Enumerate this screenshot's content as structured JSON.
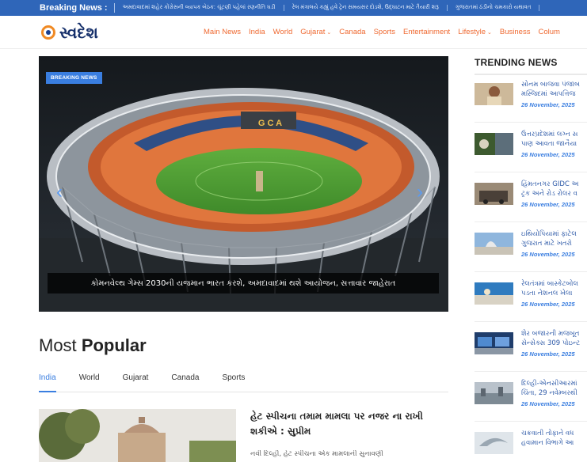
{
  "ticker": {
    "label": "Breaking News :",
    "items": [
      "અમદાવાદમાં શહેર કોંગ્રેસની વ્યાપક બેઠક: ચૂંટણી પહેલાં રણનીતિ ઘડી",
      "રેલ મંત્રાલયે કહ્યું હવે ટ્રેન સમયસર દોડશે, ઉદ્ઘાટન માટે તૈયારી શરૂ",
      "ગુજરાતમાં ઠંડીનો ચમકારો યથાવત"
    ]
  },
  "header": {
    "logo_text": "સ્વદેશ",
    "nav": [
      {
        "label": "Main News",
        "dropdown": false
      },
      {
        "label": "India",
        "dropdown": false
      },
      {
        "label": "World",
        "dropdown": false
      },
      {
        "label": "Gujarat",
        "dropdown": true
      },
      {
        "label": "Canada",
        "dropdown": false
      },
      {
        "label": "Sports",
        "dropdown": false
      },
      {
        "label": "Entertainment",
        "dropdown": false
      },
      {
        "label": "Lifestyle",
        "dropdown": true
      },
      {
        "label": "Business",
        "dropdown": false
      },
      {
        "label": "Colum",
        "dropdown": false
      }
    ]
  },
  "hero": {
    "badge": "BREAKING NEWS",
    "stadium_sign": "G C A",
    "caption": "કોમનવેલ્થ ગેમ્સ 2030ની યજમાન ભારત કરશે, અમદાવાદમાં થશે આયોજન, સત્તાવાર જાહેરાત"
  },
  "most_popular": {
    "title_light": "Most",
    "title_bold": "Popular",
    "tabs": [
      "India",
      "World",
      "Gujarat",
      "Canada",
      "Sports"
    ],
    "active_tab": "India",
    "headline": "હેટ સ્પીચના તમામ મામલા પર નજર ના રાખી શકીએ : સુપ્રીમ",
    "excerpt": "નવી દિલ્હી, હેટ સ્પીચના એક મામલાની સુનાવણી"
  },
  "trending": {
    "title": "TRENDING NEWS",
    "items": [
      {
        "line1": "સોનમ બાજવા પંજાબ",
        "line2": "મસ્જિદમાં આપત્તિજ",
        "date": "26 November, 2025"
      },
      {
        "line1": "ઉત્તરપ્રદેશમાં લગ્ન સ",
        "line2": "પાણ આવતા જાનૈયા",
        "date": "26 November, 2025"
      },
      {
        "line1": "હિંમતનગર GIDC અ",
        "line2": "ટ્રક અને રોડ રોલર વ",
        "date": "26 November, 2025"
      },
      {
        "line1": "ઇથિયોપિયામાં ફાટેલ",
        "line2": "ગુજરાત માટે ખતરો",
        "date": "26 November, 2025"
      },
      {
        "line1": "રેલતંત્રમાં બાસ્કેટબોલ",
        "line2": "પડતા નેશનલ ખેલા",
        "date": "26 November, 2025"
      },
      {
        "line1": "શેર બજારની મજબૂત",
        "line2": "સેન્સેક્સ 309 પોઇન્ટ",
        "date": "26 November, 2025"
      },
      {
        "line1": "દિલ્હી-એનસીઆરમાં",
        "line2": "ચિંતા, 29 નવેમ્બરથી",
        "date": "26 November, 2025"
      },
      {
        "line1": "ચક્રવાતી તોફાને વધ",
        "line2": "હવામાન વિભાગે આ",
        "date": ""
      }
    ]
  }
}
